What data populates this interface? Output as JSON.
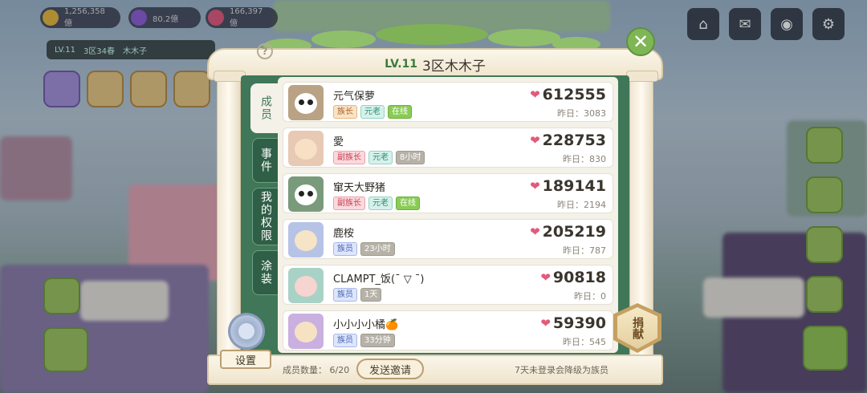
{
  "hud": {
    "resources": [
      {
        "icon": "coin-icon",
        "value": "1,256,358億",
        "color": "#e8b83a"
      },
      {
        "icon": "gem-icon",
        "value": "80.2億",
        "color": "#8e5ad6"
      },
      {
        "icon": "heart-icon",
        "value": "166,397億",
        "color": "#e2577a"
      }
    ],
    "clan_bar": {
      "level": "LV.11",
      "server": "3区34春",
      "name": "木木子"
    },
    "top_buttons": [
      "clan-icon",
      "mail-icon",
      "camera-icon",
      "settings-icon"
    ]
  },
  "panel": {
    "level": "LV.11",
    "clan_name": "3区木木子",
    "help": "?",
    "close": "✕",
    "tabs": [
      {
        "label": "成员",
        "active": true
      },
      {
        "label": "事件",
        "active": false
      },
      {
        "label": "我的权限",
        "active": false
      },
      {
        "label": "涂装",
        "active": false
      }
    ],
    "members": [
      {
        "name": "元气保萝",
        "role": "族长",
        "title": "元老",
        "status": "在线",
        "online": true,
        "score": "612555",
        "yesterday": "昨日：3083",
        "avatar": "panda"
      },
      {
        "name": "愛",
        "role": "副族长",
        "title": "元老",
        "status": "8小时",
        "online": false,
        "score": "228753",
        "yesterday": "昨日：830",
        "avatar": "girl-blonde"
      },
      {
        "name": "窜天大野猪",
        "role": "副族长",
        "title": "元老",
        "status": "在线",
        "online": true,
        "score": "189141",
        "yesterday": "昨日：2194",
        "avatar": "panda"
      },
      {
        "name": "鹿桉",
        "role": "族员",
        "title": "",
        "status": "23小时",
        "online": false,
        "score": "205219",
        "yesterday": "昨日：787",
        "avatar": "girl-blonde"
      },
      {
        "name": "CLAMPT_饭(ˉ ▽ ˉ)",
        "role": "族员",
        "title": "",
        "status": "1天",
        "online": false,
        "score": "90818",
        "yesterday": "昨日：0",
        "avatar": "girl-pink"
      },
      {
        "name": "小小小小橘🍊",
        "role": "族员",
        "title": "",
        "status": "33分钟",
        "online": false,
        "score": "59390",
        "yesterday": "昨日：545",
        "avatar": "girl-blonde"
      }
    ],
    "settings_label": "设置",
    "member_count_label": "成员数量：  6/20",
    "invite_label": "发送邀请",
    "note": "7天未登录会降级为族员",
    "donate_label": "捐献"
  }
}
